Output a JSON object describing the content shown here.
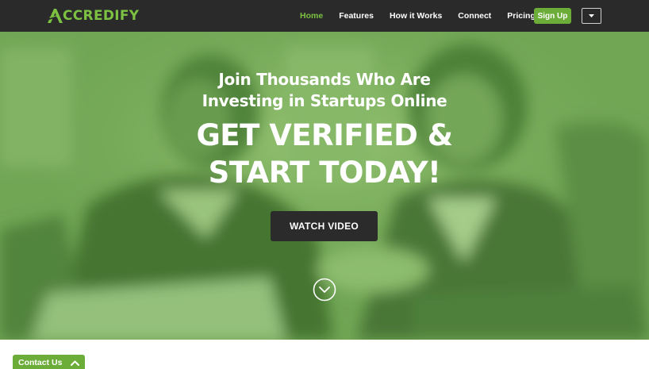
{
  "brand": {
    "name": "CCREDIFY",
    "logo_icon": "accredify-a-logo-icon",
    "accent_color": "#7cc142"
  },
  "nav": {
    "items": [
      {
        "label": "Home",
        "active": true
      },
      {
        "label": "Features",
        "active": false
      },
      {
        "label": "How it Works",
        "active": false
      },
      {
        "label": "Connect",
        "active": false
      },
      {
        "label": "Pricing",
        "active": false
      }
    ],
    "signup_label": "Sign Up",
    "dropdown_icon": "caret-down-icon"
  },
  "hero": {
    "subtitle_line1": "Join Thousands Who Are",
    "subtitle_line2": "Investing in Startups Online",
    "headline_line1": "GET VERIFIED &",
    "headline_line2": "START TODAY!",
    "cta_label": "WATCH VIDEO",
    "scroll_icon": "chevron-down-circle-icon",
    "overlay_color": "#6b9e52"
  },
  "contact": {
    "label": "Contact Us",
    "toggle_icon": "chevron-up-icon"
  }
}
